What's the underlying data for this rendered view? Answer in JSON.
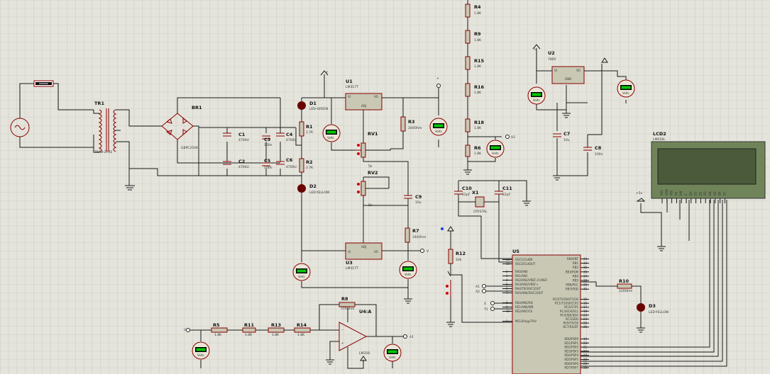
{
  "schematic": {
    "resistors_chain": [
      {
        "ref": "R4",
        "value": "1.8K"
      },
      {
        "ref": "R9",
        "value": "1.8K"
      },
      {
        "ref": "R15",
        "value": "1.8K"
      },
      {
        "ref": "R16",
        "value": "1.8K"
      },
      {
        "ref": "R18",
        "value": "1.8K"
      },
      {
        "ref": "R6",
        "value": "1.8K"
      }
    ],
    "tr1": {
      "ref": "TR1",
      "value": "TRAN-2P3S"
    },
    "br1": {
      "ref": "BR1",
      "value": "GBPC2506"
    },
    "caps": [
      {
        "ref": "C1",
        "value": "4700U"
      },
      {
        "ref": "C2",
        "value": "4700U"
      },
      {
        "ref": "C3",
        "value": "100n"
      },
      {
        "ref": "C4",
        "value": "4700U"
      },
      {
        "ref": "C5",
        "value": "100n"
      },
      {
        "ref": "C6",
        "value": "4700U"
      },
      {
        "ref": "C7",
        "value": "10u"
      },
      {
        "ref": "C8",
        "value": "100n"
      },
      {
        "ref": "C9",
        "value": "10u"
      },
      {
        "ref": "C10",
        "value": "22pF"
      },
      {
        "ref": "C11",
        "value": "22pF"
      }
    ],
    "d1": {
      "ref": "D1",
      "value": "LED-GREEN"
    },
    "d2": {
      "ref": "D2",
      "value": "LED-YELLOW"
    },
    "d3": {
      "ref": "D3",
      "value": "LED-YELLOW"
    },
    "r1": {
      "ref": "R1",
      "value": "2.7K"
    },
    "r2": {
      "ref": "R2",
      "value": "2.7K"
    },
    "r3": {
      "ref": "R3",
      "value": "240Ohm"
    },
    "r7": {
      "ref": "R7",
      "value": "240Ohm"
    },
    "r8": {
      "ref": "R8",
      "value": "370Ohm"
    },
    "r5": {
      "ref": "R5",
      "value": "1.8K"
    },
    "r11": {
      "ref": "R11",
      "value": "1.8K"
    },
    "r13": {
      "ref": "R13",
      "value": "1.8K"
    },
    "r14": {
      "ref": "R14",
      "value": "1.8K"
    },
    "r12": {
      "ref": "R12",
      "value": "10k"
    },
    "r10": {
      "ref": "R10",
      "value": "220Ohm"
    },
    "rv1": {
      "ref": "RV1",
      "value": "5k"
    },
    "rv2": {
      "ref": "RV2",
      "value": "5k"
    },
    "u1": {
      "ref": "U1",
      "value": "LM317T",
      "pin_vi": "VI",
      "pin_vo": "VO",
      "pin_adj": "ADJ"
    },
    "u3": {
      "ref": "U3",
      "value": "LM317T",
      "pin_vi": "VI",
      "pin_vo": "VO",
      "pin_adj": "ADJ"
    },
    "u2": {
      "ref": "U2",
      "value": "7805",
      "pin_vi": "VI",
      "pin_vo": "VO",
      "pin_gnd": "GND"
    },
    "u4": {
      "ref": "U4:A",
      "value": "LM358"
    },
    "x1": {
      "ref": "X1",
      "value": "CRYSTAL"
    },
    "lcd": {
      "ref": "LCD2",
      "value": "LM016L",
      "pins": [
        "VSS",
        "VDD",
        "VEE",
        "RS",
        "RW",
        "E",
        "D0",
        "D1",
        "D2",
        "D3",
        "D4",
        "D5",
        "D6",
        "D7"
      ]
    },
    "u5": {
      "ref": "U5",
      "left_pins": [
        "OSC1/CLKIN",
        "OSC2/CLKOUT",
        "RA0/AN0",
        "RA1/AN1",
        "RA2/AN2/VREF-/CVREF",
        "RA3/AN3/VREF+",
        "RA4/T0CKI/C1OUT",
        "RA5/AN4/SS/C2OUT",
        "RE0/AN5/RD",
        "RE1/AN6/WR",
        "RE2/AN7/CS",
        "MCLR/Vpp/THV"
      ],
      "right_pins": [
        "RB0/INT",
        "RB1",
        "RB2",
        "RB3/PGM",
        "RB4",
        "RB5",
        "RB6/PGC",
        "RB7/PGD",
        "RC0/T1OSO/T1CKI",
        "RC1/T1OSI/CCP2",
        "RC2/CCP1",
        "RC3/SCK/SCL",
        "RC4/SDI/SDA",
        "RC5/SDO",
        "RC6/TX/CK",
        "RC7/RX/DT",
        "RD0/PSP0",
        "RD1/PSP1",
        "RD2/PSP2",
        "RD3/PSP3",
        "RD4/PSP4",
        "RD5/PSP5",
        "RD6/PSP6",
        "RD7/PSP7"
      ],
      "right_nums": [
        "33",
        "34",
        "35",
        "36",
        "37",
        "38",
        "39",
        "40",
        "15",
        "16",
        "17",
        "18",
        "23",
        "24",
        "25",
        "26",
        "19",
        "20",
        "21",
        "22",
        "27",
        "28",
        "29",
        "30"
      ],
      "left_nums": [
        "13",
        "14",
        "2",
        "3",
        "4",
        "5",
        "6",
        "7",
        "8",
        "9",
        "10",
        "1"
      ]
    },
    "net_labels": {
      "a1": "A1",
      "a2": "A2",
      "v": "V",
      "a1b": "A1",
      "s": "S",
      "t1": "T1",
      "b5": "+5v"
    },
    "meter_label": "Volts",
    "supply_arrow_label": "+",
    "pot_mid": "5k"
  }
}
